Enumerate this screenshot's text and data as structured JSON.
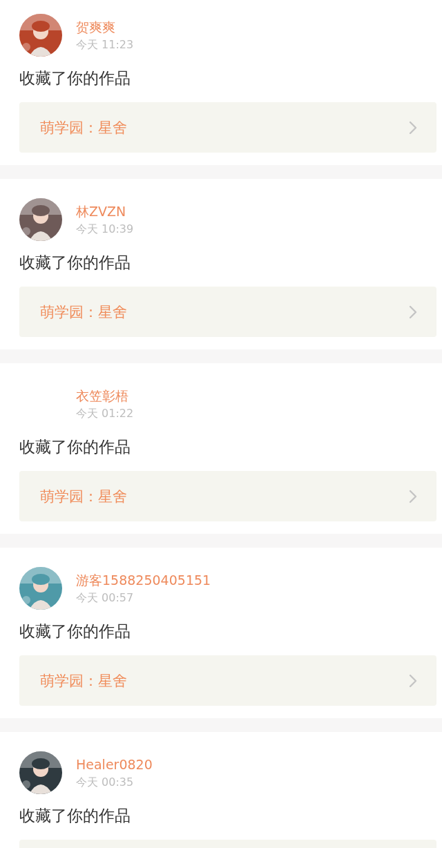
{
  "posts": [
    {
      "name": "贺爽爽",
      "time": "今天 11:23",
      "action": "收藏了你的作品",
      "link": "萌学园：星舍"
    },
    {
      "name": "林ZVZN",
      "time": "今天 10:39",
      "action": "收藏了你的作品",
      "link": "萌学园：星舍"
    },
    {
      "name": "衣笠彰梧",
      "time": "今天 01:22",
      "action": "收藏了你的作品",
      "link": "萌学园：星舍"
    },
    {
      "name": "游客1588250405151",
      "time": "今天 00:57",
      "action": "收藏了你的作品",
      "link": "萌学园：星舍"
    },
    {
      "name": "Healer0820",
      "time": "今天 00:35",
      "action": "收藏了你的作品"
    }
  ]
}
